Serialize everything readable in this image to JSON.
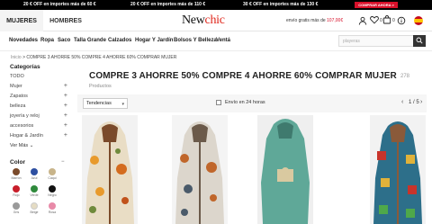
{
  "promo": {
    "items": [
      "20 € OFF en importes más de 60 €",
      "20 € OFF en importes más de 110 €",
      "30 € OFF en importes más de 130 €"
    ],
    "button": "COMPRAR AHORA >"
  },
  "header": {
    "tabs": [
      "MUJERES",
      "HOMBRES"
    ],
    "logo_a": "New",
    "logo_b": "chic",
    "shipping_text": "envío gratis más de",
    "shipping_price": "107,00€",
    "cart_count": "0",
    "wish_count": "0"
  },
  "nav": {
    "items": [
      "Novedades",
      "Ropa",
      "Saco",
      "Talla Grande",
      "Calzados",
      "Hogar Y Jardín",
      "Bolsos Y Belleza",
      "Ventá"
    ],
    "search_placeholder": "playeras"
  },
  "breadcrumb": {
    "home": "Inicio",
    "sep": ">",
    "current": "COMPRE 3 AHORRE 50% COMPRE 4 AHORRE 60% COMPRAR MUJER"
  },
  "sidebar": {
    "categories_title": "Categorías",
    "categories": [
      "TODO",
      "Mujer",
      "Zapatos",
      "belleza",
      "joyería y reloj",
      "accesorios",
      "Hogar & Jardín"
    ],
    "see_more": "Ver Más",
    "color_title": "Color",
    "colors": [
      {
        "label": "Marrón",
        "hex": "#7a4a2a"
      },
      {
        "label": "Azul",
        "hex": "#2d4fa1"
      },
      {
        "label": "Caqui",
        "hex": "#c8b48a"
      },
      {
        "label": "Rojo",
        "hex": "#c81e2a"
      },
      {
        "label": "Verde",
        "hex": "#2f8a3c"
      },
      {
        "label": "Negro",
        "hex": "#111111"
      },
      {
        "label": "Gris",
        "hex": "#9a9a9a"
      },
      {
        "label": "Beige",
        "hex": "#e5dcc3"
      },
      {
        "label": "Rosa",
        "hex": "#e88aa8"
      }
    ]
  },
  "main": {
    "title": "COMPRE 3 AHORRE 50% COMPRE 4 AHORRE 60% COMPRAR MUJER",
    "count": "278",
    "subtitle": "Productos",
    "sort": "Tendencias",
    "ship24": "Envío en 24 horas",
    "page": "1 / 5"
  },
  "products": [
    {
      "name": "floral-hooded-coat-khaki",
      "main": "#e9ddc5",
      "accent": "#e89a2c"
    },
    {
      "name": "floral-hooded-coat-grey",
      "main": "#dcd6cc",
      "accent": "#c0662a"
    },
    {
      "name": "hoodie-mint",
      "main": "#5fa898",
      "accent": "#d9c9a0"
    },
    {
      "name": "patterned-hooded-coat",
      "main": "#2d6f8a",
      "accent": "#c8342b"
    }
  ],
  "colors": {
    "accent": "#d8102a",
    "brand_red": "#e0261b"
  }
}
